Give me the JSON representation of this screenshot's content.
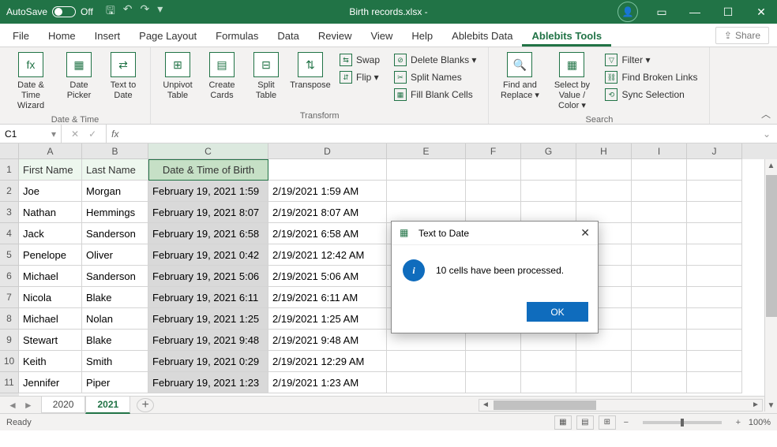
{
  "titlebar": {
    "autosave_label": "AutoSave",
    "autosave_state": "Off",
    "filename": "Birth records.xlsx  -"
  },
  "tabs": {
    "file": "File",
    "home": "Home",
    "insert": "Insert",
    "page_layout": "Page Layout",
    "formulas": "Formulas",
    "data": "Data",
    "review": "Review",
    "view": "View",
    "help": "Help",
    "ablebits_data": "Ablebits Data",
    "ablebits_tools": "Ablebits Tools",
    "share": "Share"
  },
  "ribbon": {
    "date_time_wizard": "Date & Time Wizard",
    "date_picker": "Date Picker",
    "text_to_date": "Text to Date",
    "group_datetime": "Date & Time",
    "unpivot_table": "Unpivot Table",
    "create_cards": "Create Cards",
    "split_table": "Split Table",
    "transpose": "Transpose",
    "swap": "Swap",
    "flip": "Flip ▾",
    "delete_blanks": "Delete Blanks ▾",
    "split_names": "Split Names",
    "fill_blank_cells": "Fill Blank Cells",
    "group_transform": "Transform",
    "find_replace": "Find and Replace ▾",
    "select_by": "Select by Value / Color ▾",
    "filter": "Filter ▾",
    "find_broken": "Find Broken Links",
    "sync_selection": "Sync Selection",
    "group_search": "Search"
  },
  "formulabar": {
    "cell_ref": "C1",
    "fx_label": "fx",
    "value": ""
  },
  "columns": [
    "A",
    "B",
    "C",
    "D",
    "E",
    "F",
    "G",
    "H",
    "I",
    "J"
  ],
  "headers": {
    "a": "First Name",
    "b": "Last Name",
    "c": "Date & Time of Birth"
  },
  "rows": [
    {
      "n": "2",
      "a": "Joe",
      "b": "Morgan",
      "c": "February 19, 2021 1:59",
      "d": "2/19/2021 1:59 AM"
    },
    {
      "n": "3",
      "a": "Nathan",
      "b": "Hemmings",
      "c": "February 19, 2021 8:07",
      "d": "2/19/2021 8:07 AM"
    },
    {
      "n": "4",
      "a": "Jack",
      "b": "Sanderson",
      "c": "February 19, 2021 6:58",
      "d": "2/19/2021 6:58 AM"
    },
    {
      "n": "5",
      "a": "Penelope",
      "b": "Oliver",
      "c": "February 19, 2021 0:42",
      "d": "2/19/2021 12:42 AM"
    },
    {
      "n": "6",
      "a": "Michael",
      "b": "Sanderson",
      "c": "February 19, 2021 5:06",
      "d": "2/19/2021 5:06 AM"
    },
    {
      "n": "7",
      "a": "Nicola",
      "b": "Blake",
      "c": "February 19, 2021 6:11",
      "d": "2/19/2021 6:11 AM"
    },
    {
      "n": "8",
      "a": "Michael",
      "b": "Nolan",
      "c": "February 19, 2021 1:25",
      "d": "2/19/2021 1:25 AM"
    },
    {
      "n": "9",
      "a": "Stewart",
      "b": "Blake",
      "c": "February 19, 2021 9:48",
      "d": "2/19/2021 9:48 AM"
    },
    {
      "n": "10",
      "a": "Keith",
      "b": "Smith",
      "c": "February 19, 2021 0:29",
      "d": "2/19/2021 12:29 AM"
    },
    {
      "n": "11",
      "a": "Jennifer",
      "b": "Piper",
      "c": "February 19, 2021 1:23",
      "d": "2/19/2021 1:23 AM"
    }
  ],
  "sheets": {
    "s1": "2020",
    "s2": "2021"
  },
  "statusbar": {
    "ready": "Ready",
    "zoom": "100%"
  },
  "dialog": {
    "title": "Text to Date",
    "message": "10 cells have been processed.",
    "ok": "OK"
  }
}
